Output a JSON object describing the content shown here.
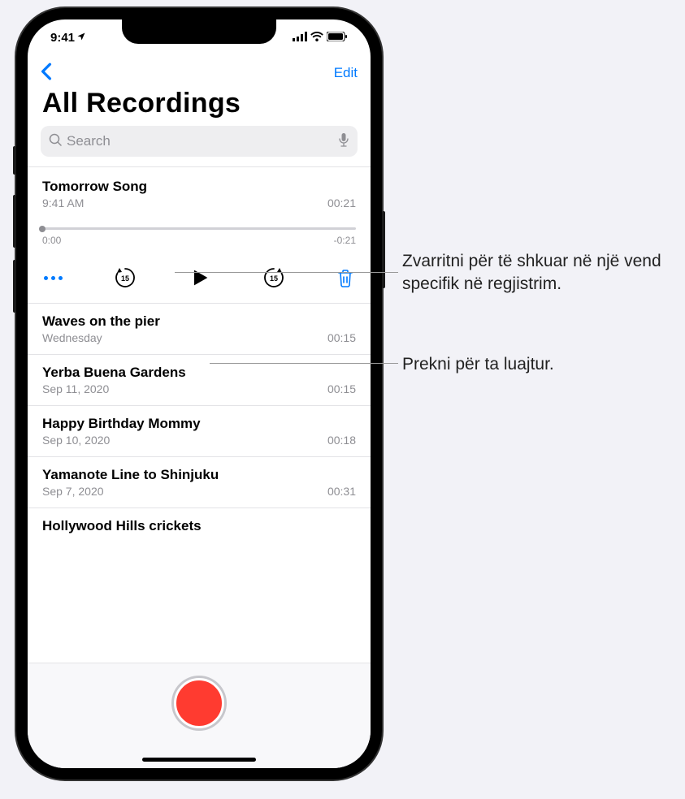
{
  "status": {
    "time": "9:41",
    "location_arrow": "➤"
  },
  "nav": {
    "edit_label": "Edit"
  },
  "title": "All Recordings",
  "search": {
    "placeholder": "Search"
  },
  "expanded": {
    "title": "Tomorrow Song",
    "time": "9:41 AM",
    "duration": "00:21",
    "scrub_start": "0:00",
    "scrub_end": "-0:21"
  },
  "recordings": [
    {
      "title": "Waves on the pier",
      "date": "Wednesday",
      "duration": "00:15"
    },
    {
      "title": "Yerba Buena Gardens",
      "date": "Sep 11, 2020",
      "duration": "00:15"
    },
    {
      "title": "Happy Birthday Mommy",
      "date": "Sep 10, 2020",
      "duration": "00:18"
    },
    {
      "title": "Yamanote Line to Shinjuku",
      "date": "Sep 7, 2020",
      "duration": "00:31"
    },
    {
      "title": "Hollywood Hills crickets",
      "date": "",
      "duration": ""
    }
  ],
  "callouts": {
    "scrub": "Zvarritni për të shkuar në një vend specifik në regjistrim.",
    "play": "Prekni për ta luajtur."
  },
  "colors": {
    "accent": "#007aff",
    "record": "#ff3b30"
  }
}
